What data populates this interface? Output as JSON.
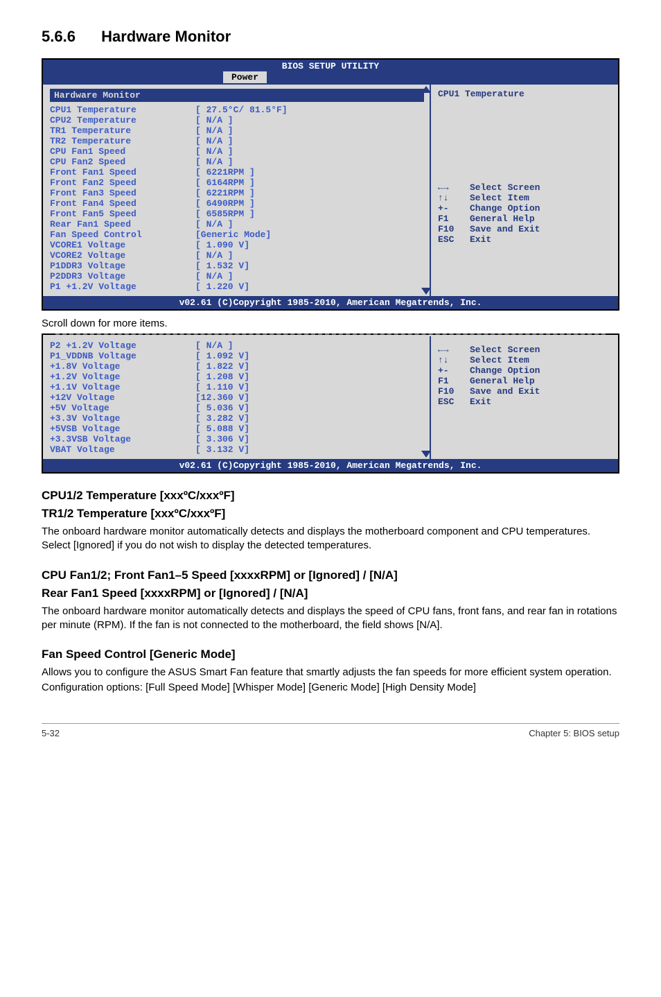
{
  "section": {
    "number": "5.6.6",
    "title": "Hardware Monitor"
  },
  "bios1": {
    "utility_title": "BIOS SETUP UTILITY",
    "tab": "Power",
    "header": "Hardware Monitor",
    "rows": [
      {
        "label": "CPU1 Temperature",
        "value": "[ 27.5°C/ 81.5°F]"
      },
      {
        "label": "CPU2 Temperature",
        "value": "[   N/A   ]"
      },
      {
        "label": "TR1 Temperature",
        "value": "[   N/A   ]"
      },
      {
        "label": "TR2 Temperature",
        "value": "[   N/A   ]"
      },
      {
        "label": "CPU Fan1 Speed",
        "value": "[   N/A   ]"
      },
      {
        "label": "CPU Fan2 Speed",
        "value": "[   N/A   ]"
      },
      {
        "label": "Front Fan1 Speed",
        "value": "[ 6221RPM ]"
      },
      {
        "label": "Front Fan2 Speed",
        "value": "[ 6164RPM ]"
      },
      {
        "label": "Front Fan3 Speed",
        "value": "[ 6221RPM ]"
      },
      {
        "label": "Front Fan4 Speed",
        "value": "[ 6490RPM ]"
      },
      {
        "label": "Front Fan5 Speed",
        "value": "[ 6585RPM ]"
      },
      {
        "label": "Rear Fan1 Speed",
        "value": "[   N/A   ]"
      },
      {
        "label": "Fan Speed Control",
        "value": "[Generic Mode]"
      },
      {
        "label": "VCORE1 Voltage",
        "value": "[ 1.090 V]"
      },
      {
        "label": "VCORE2 Voltage",
        "value": "[  N/A  ]"
      },
      {
        "label": "P1DDR3 Voltage",
        "value": "[ 1.532 V]"
      },
      {
        "label": "P2DDR3 Voltage",
        "value": "[  N/A  ]"
      },
      {
        "label": "P1 +1.2V Voltage",
        "value": "[ 1.220 V]"
      }
    ],
    "right_title": "CPU1 Temperature",
    "help": [
      {
        "key": "←→",
        "desc": "Select Screen"
      },
      {
        "key": "↑↓",
        "desc": "Select Item"
      },
      {
        "key": "+-",
        "desc": "Change Option"
      },
      {
        "key": "F1",
        "desc": "General Help"
      },
      {
        "key": "F10",
        "desc": "Save and Exit"
      },
      {
        "key": "ESC",
        "desc": "Exit"
      }
    ],
    "footer": "v02.61 (C)Copyright 1985-2010, American Megatrends, Inc."
  },
  "scroll_note": "Scroll down for more items.",
  "bios2": {
    "rows": [
      {
        "label": "P2 +1.2V Voltage",
        "value": "[  N/A  ]"
      },
      {
        "label": "P1_VDDNB Voltage",
        "value": "[ 1.092 V]"
      },
      {
        "label": "+1.8V Voltage",
        "value": "[ 1.822 V]"
      },
      {
        "label": "+1.2V Voltage",
        "value": "[ 1.208 V]"
      },
      {
        "label": "+1.1V Voltage",
        "value": "[ 1.110 V]"
      },
      {
        "label": "+12V Voltage",
        "value": "[12.360 V]"
      },
      {
        "label": "+5V Voltage",
        "value": "[ 5.036 V]"
      },
      {
        "label": "+3.3V Voltage",
        "value": "[ 3.282 V]"
      },
      {
        "label": "+5VSB Voltage",
        "value": "[ 5.088 V]"
      },
      {
        "label": "+3.3VSB Voltage",
        "value": "[ 3.306 V]"
      },
      {
        "label": "VBAT Voltage",
        "value": "[ 3.132 V]"
      }
    ],
    "help": [
      {
        "key": "←→",
        "desc": "Select Screen"
      },
      {
        "key": "↑↓",
        "desc": "Select Item"
      },
      {
        "key": "+-",
        "desc": "Change Option"
      },
      {
        "key": "F1",
        "desc": "General Help"
      },
      {
        "key": "F10",
        "desc": "Save and Exit"
      },
      {
        "key": "ESC",
        "desc": "Exit"
      }
    ],
    "footer": "v02.61 (C)Copyright 1985-2010, American Megatrends, Inc."
  },
  "doc": {
    "h1a": "CPU1/2 Temperature [xxxºC/xxxºF]",
    "h1b": "TR1/2 Temperature [xxxºC/xxxºF]",
    "p1": "The onboard hardware monitor automatically detects and displays the motherboard component and CPU temperatures. Select [Ignored] if you do not wish to display the detected temperatures.",
    "h2a": "CPU Fan1/2; Front Fan1–5 Speed [xxxxRPM] or [Ignored] / [N/A]",
    "h2b": "Rear Fan1 Speed [xxxxRPM] or [Ignored] / [N/A]",
    "p2": "The onboard hardware monitor automatically detects and displays the speed of CPU fans, front fans, and rear fan in rotations per minute (RPM). If the fan is not connected to the motherboard, the field shows [N/A].",
    "h3": "Fan Speed Control [Generic Mode]",
    "p3a": "Allows you to configure the ASUS Smart Fan feature that smartly adjusts the fan speeds for more efficient system operation.",
    "p3b": "Configuration options: [Full Speed Mode] [Whisper Mode] [Generic Mode] [High Density Mode]"
  },
  "footer": {
    "left": "5-32",
    "right": "Chapter 5: BIOS setup"
  }
}
